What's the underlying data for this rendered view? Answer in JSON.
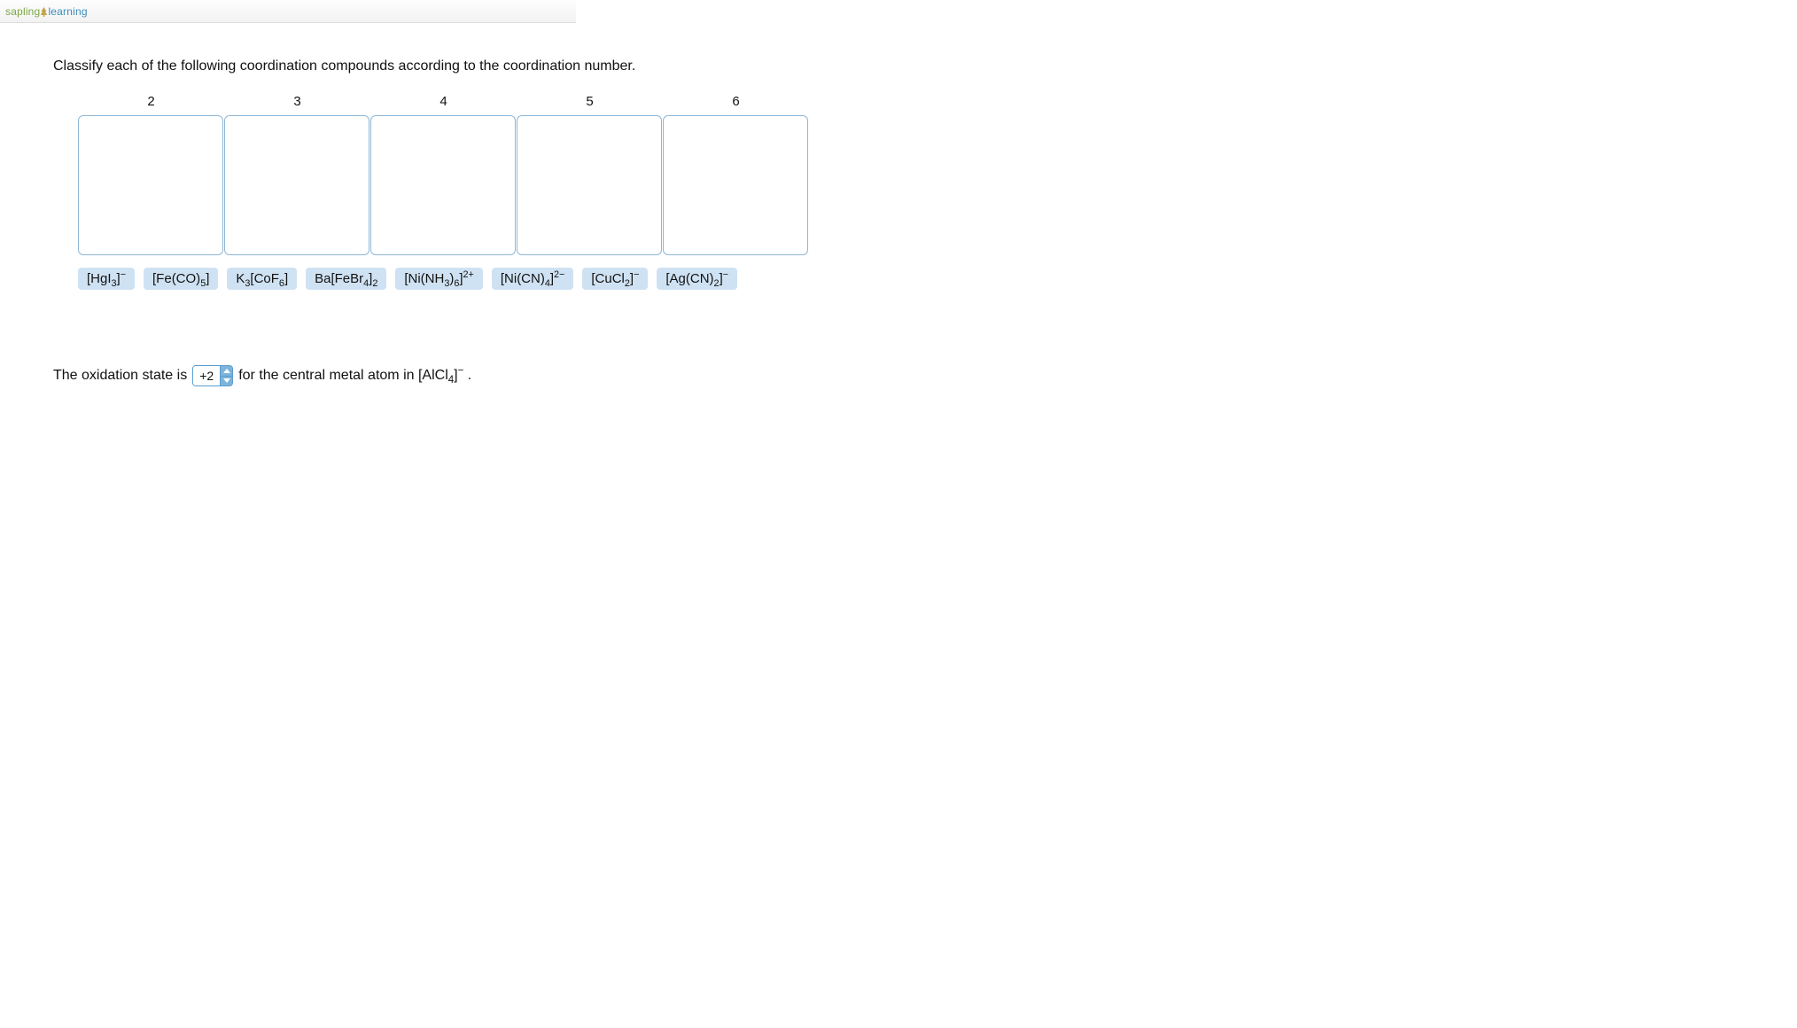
{
  "brand": {
    "sapling": "sapling",
    "learning": "learning"
  },
  "question": "Classify each of the following coordination compounds according to the coordination number.",
  "bins": [
    {
      "label": "2"
    },
    {
      "label": "3"
    },
    {
      "label": "4"
    },
    {
      "label": "5"
    },
    {
      "label": "6"
    }
  ],
  "chips": [
    {
      "id": "hgi3",
      "html": "[HgI<sub>3</sub>]<sup>−</sup>"
    },
    {
      "id": "feco5",
      "html": "[Fe(CO)<sub>5</sub>]"
    },
    {
      "id": "k3cof6",
      "html": "K<sub>3</sub>[CoF<sub>6</sub>]"
    },
    {
      "id": "bafebr4",
      "html": "Ba[FeBr<sub>4</sub>]<sub>2</sub>"
    },
    {
      "id": "ninh36",
      "html": "[Ni(NH<sub>3</sub>)<sub>6</sub>]<sup>2+</sup>"
    },
    {
      "id": "nicn4",
      "html": "[Ni(CN)<sub>4</sub>]<sup>2−</sup>"
    },
    {
      "id": "cucl2",
      "html": "[CuCl<sub>2</sub>]<sup>−</sup>"
    },
    {
      "id": "agcn2",
      "html": "[Ag(CN)<sub>2</sub>]<sup>−</sup>"
    }
  ],
  "oxidation": {
    "prefix": "The oxidation state is",
    "value": "+2",
    "suffix_html": "for the central metal atom in [AlCl<sub>4</sub>]<sup>−</sup> ."
  }
}
